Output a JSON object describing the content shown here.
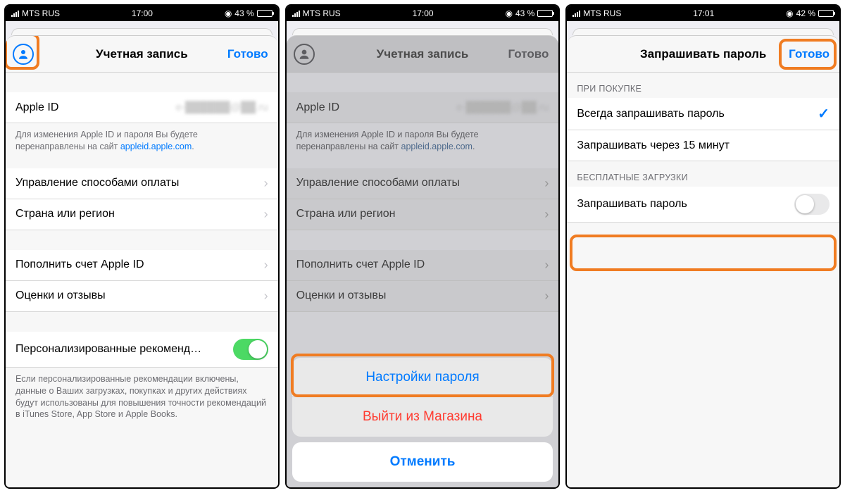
{
  "status": {
    "carrier": "MTS RUS",
    "time1": "17:00",
    "time2": "17:00",
    "time3": "17:01",
    "battery1": "43 %",
    "battery2": "43 %",
    "battery3": "42 %",
    "charging_glyph": "◉"
  },
  "screen1": {
    "title": "Учетная запись",
    "done": "Готово",
    "appleid_label": "Apple ID",
    "appleid_value": "",
    "help_prefix": "Для изменения Apple ID и пароля Вы будете перенаправлены на сайт ",
    "help_link": "appleid.apple.com",
    "help_suffix": ".",
    "row_payment": "Управление способами оплаты",
    "row_region": "Страна или регион",
    "row_fund": "Пополнить счет Apple ID",
    "row_reviews": "Оценки и отзывы",
    "row_personal": "Персонализированные рекоменд…",
    "personal_footer": "Если персонализированные рекомендации включены, данные о Ваших загрузках, покупках и других действиях будут использованы для повышения точности рекомендаций в iTunes Store, App Store и Apple Books."
  },
  "screen2": {
    "title": "Учетная запись",
    "done": "Готово",
    "appleid_label": "Apple ID",
    "row_payment": "Управление способами оплаты",
    "row_region": "Страна или регион",
    "row_fund": "Пополнить счет Apple ID",
    "row_reviews": "Оценки и отзывы",
    "help_prefix": "Для изменения Apple ID и пароля Вы будете перенаправлены на сайт ",
    "help_link": "appleid.apple.com",
    "help_suffix": ".",
    "as_password": "Настройки пароля",
    "as_signout": "Выйти из Магазина",
    "as_cancel": "Отменить"
  },
  "screen3": {
    "title": "Запрашивать пароль",
    "done": "Готово",
    "header_purchase": "ПРИ ПОКУПКЕ",
    "opt_always": "Всегда запрашивать пароль",
    "opt_15min": "Запрашивать через 15 минут",
    "header_free": "БЕСПЛАТНЫЕ ЗАГРУЗКИ",
    "row_require": "Запрашивать пароль"
  }
}
